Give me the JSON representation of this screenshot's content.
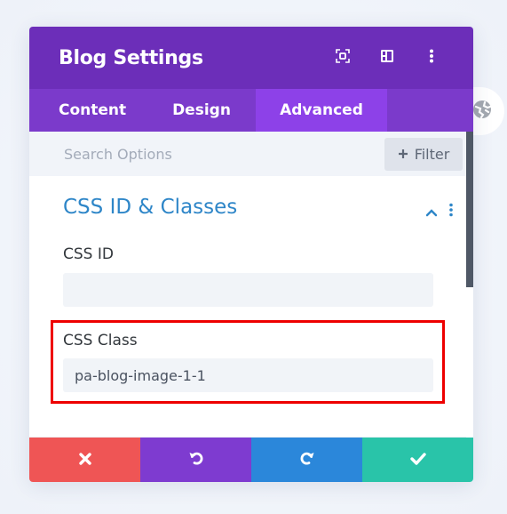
{
  "modal": {
    "title": "Blog Settings",
    "header_icons": [
      "focus-icon",
      "split-view-icon",
      "more-vertical-icon"
    ]
  },
  "tabs": [
    {
      "label": "Content",
      "active": false
    },
    {
      "label": "Design",
      "active": false
    },
    {
      "label": "Advanced",
      "active": true
    }
  ],
  "search": {
    "placeholder": "Search Options",
    "value": "",
    "filter_label": "Filter"
  },
  "section": {
    "title": "CSS ID & Classes",
    "expanded": true
  },
  "fields": {
    "css_id": {
      "label": "CSS ID",
      "value": ""
    },
    "css_class": {
      "label": "CSS Class",
      "value": "pa-blog-image-1-1",
      "highlighted": true
    }
  },
  "footer": {
    "buttons": [
      {
        "name": "discard",
        "icon": "close-icon"
      },
      {
        "name": "undo",
        "icon": "undo-icon"
      },
      {
        "name": "redo",
        "icon": "redo-icon"
      },
      {
        "name": "save",
        "icon": "check-icon"
      }
    ]
  },
  "colors": {
    "header": "#6c2eb9",
    "tabs": "#7b3acb",
    "active_tab": "#8d41e8",
    "section_title": "#2e86c8",
    "highlight": "#ee0000",
    "cancel": "#ef5555",
    "undo": "#7e3bd0",
    "redo": "#2b87da",
    "save": "#29c4a9"
  }
}
